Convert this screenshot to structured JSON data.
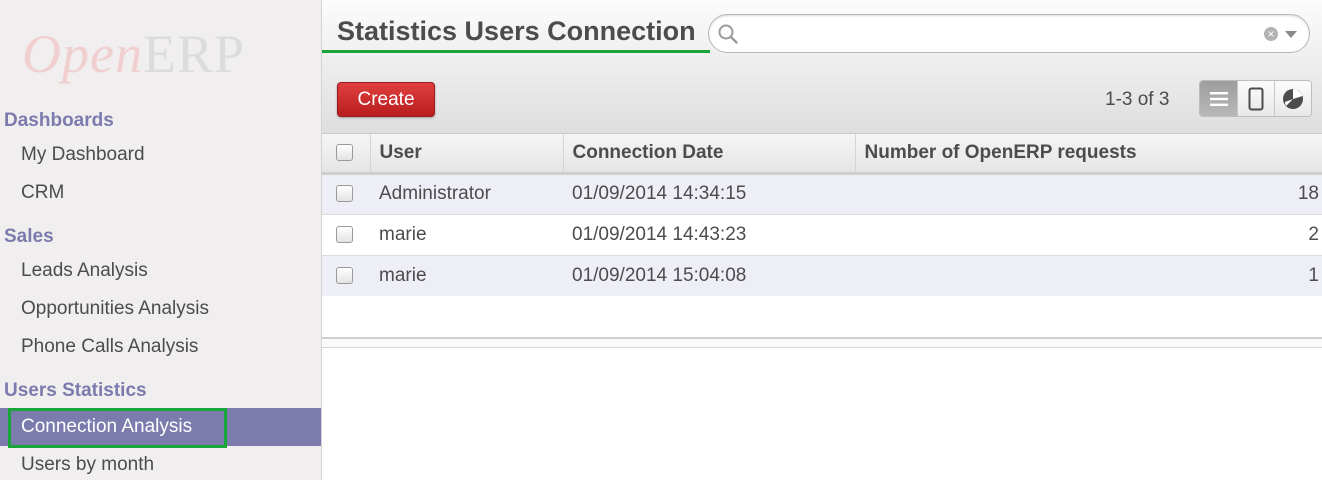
{
  "brand": {
    "logo_open": "Open",
    "logo_erp": "ERP"
  },
  "sidebar": {
    "sections": [
      {
        "title": "Dashboards",
        "items": [
          "My Dashboard",
          "CRM"
        ]
      },
      {
        "title": "Sales",
        "items": [
          "Leads Analysis",
          "Opportunities Analysis",
          "Phone Calls Analysis"
        ]
      },
      {
        "title": "Users Statistics",
        "items": [
          "Connection Analysis",
          "Users by month"
        ]
      }
    ],
    "active_item": "Connection Analysis"
  },
  "header": {
    "title": "Statistics Users Connection",
    "search": {
      "placeholder": "",
      "value": ""
    },
    "create_label": "Create",
    "pager": "1-3 of 3",
    "views": [
      "list-view-icon",
      "form-view-icon",
      "graph-view-icon"
    ],
    "active_view": "list-view-icon"
  },
  "table": {
    "columns": [
      "User",
      "Connection Date",
      "Number of OpenERP requests"
    ],
    "rows": [
      [
        "Administrator",
        "01/09/2014 14:34:15",
        "18"
      ],
      [
        "marie",
        "01/09/2014 14:43:23",
        "2"
      ],
      [
        "marie",
        "01/09/2014 15:04:08",
        "1"
      ]
    ]
  },
  "colors": {
    "accent_purple": "#7c7bad",
    "create_red": "#d42f2f",
    "highlight_green": "#1aa53a",
    "row_stripe": "#eeeef7"
  }
}
